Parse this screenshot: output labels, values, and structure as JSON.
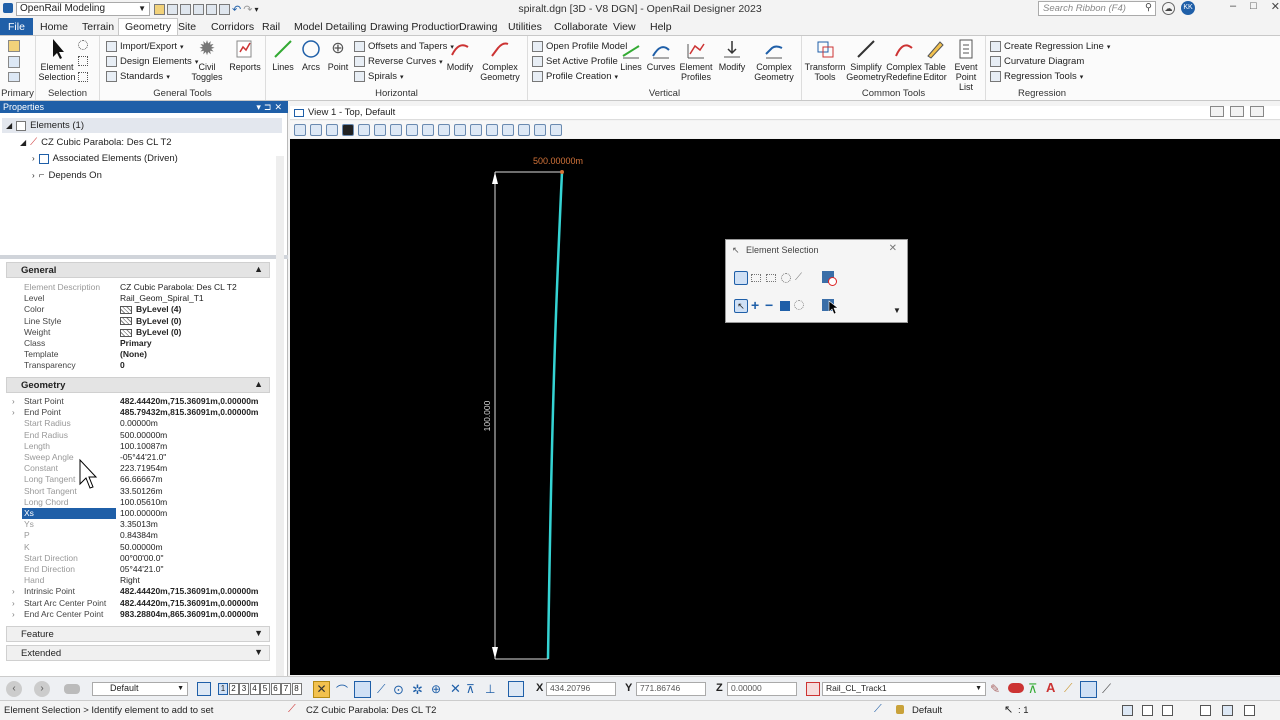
{
  "titlebar": {
    "workspace": "OpenRail Modeling",
    "title": "spiralt.dgn [3D - V8 DGN] - OpenRail Designer 2023",
    "search_placeholder": "Search Ribbon (F4)",
    "avatar": "KK"
  },
  "tabs": [
    "File",
    "Home",
    "Terrain",
    "Geometry",
    "Site",
    "Corridors",
    "Rail",
    "Model Detailing",
    "Drawing Production",
    "Drawing",
    "Utilities",
    "Collaborate",
    "View",
    "Help"
  ],
  "ribbon": {
    "primary": {
      "label": "Primary"
    },
    "selection": {
      "label": "Selection",
      "element_selection": "Element Selection"
    },
    "general_tools": {
      "label": "General Tools",
      "import_export": "Import/Export",
      "design_elements": "Design Elements",
      "standards": "Standards",
      "civil_toggles": "Civil Toggles",
      "reports": "Reports"
    },
    "horizontal": {
      "label": "Horizontal",
      "lines": "Lines",
      "arcs": "Arcs",
      "point": "Point",
      "offsets": "Offsets and Tapers",
      "reverse": "Reverse Curves",
      "spirals": "Spirals",
      "modify": "Modify",
      "complex": "Complex Geometry"
    },
    "vertical": {
      "label": "Vertical",
      "open_profile": "Open Profile Model",
      "set_active": "Set Active Profile",
      "profile_creation": "Profile Creation",
      "lines": "Lines",
      "curves": "Curves",
      "element_profiles": "Element Profiles",
      "modify": "Modify",
      "complex": "Complex Geometry"
    },
    "common": {
      "label": "Common Tools",
      "transform": "Transform Tools",
      "simplify": "Simplify Geometry",
      "complex_redefine": "Complex Redefine",
      "table_editor": "Table Editor",
      "event_point": "Event Point List"
    },
    "regression": {
      "label": "Regression",
      "create_line": "Create Regression Line",
      "curvature": "Curvature Diagram",
      "tools": "Regression Tools"
    }
  },
  "properties": {
    "header": "Properties",
    "tree": {
      "root": "Elements (1)",
      "element": "CZ Cubic Parabola: Des CL T2",
      "assoc": "Associated Elements (Driven)",
      "depends": "Depends On"
    },
    "general_label": "General",
    "general": [
      {
        "k": "Element Description",
        "v": "CZ Cubic Parabola: Des CL T2",
        "dim": true
      },
      {
        "k": "Level",
        "v": "Rail_Geom_Spiral_T1"
      },
      {
        "k": "Color",
        "v": "ByLevel (4)",
        "sw": true,
        "b": true
      },
      {
        "k": "Line Style",
        "v": "ByLevel (0)",
        "sw": true,
        "b": true
      },
      {
        "k": "Weight",
        "v": "ByLevel (0)",
        "sw": true,
        "b": true
      },
      {
        "k": "Class",
        "v": "Primary",
        "b": true
      },
      {
        "k": "Template",
        "v": "(None)",
        "b": true
      },
      {
        "k": "Transparency",
        "v": "0",
        "b": true
      }
    ],
    "geometry_label": "Geometry",
    "geometry": [
      {
        "k": "Start Point",
        "v": "482.44420m,715.36091m,0.00000m",
        "b": true,
        "ex": true
      },
      {
        "k": "End Point",
        "v": "485.79432m,815.36091m,0.00000m",
        "b": true,
        "ex": true
      },
      {
        "k": "Start Radius",
        "v": "0.00000m",
        "dim": true
      },
      {
        "k": "End Radius",
        "v": "500.00000m",
        "dim": true
      },
      {
        "k": "Length",
        "v": "100.10087m",
        "dim": true
      },
      {
        "k": "Sweep Angle",
        "v": "-05°44'21.0\"",
        "dim": true
      },
      {
        "k": "Constant",
        "v": "223.71954m",
        "dim": true
      },
      {
        "k": "Long Tangent",
        "v": "66.66667m",
        "dim": true
      },
      {
        "k": "Short Tangent",
        "v": "33.50126m",
        "dim": true
      },
      {
        "k": "Long Chord",
        "v": "100.05610m",
        "dim": true
      },
      {
        "k": "Xs",
        "v": "100.00000m",
        "sel": true
      },
      {
        "k": "Ys",
        "v": "3.35013m",
        "dim": true
      },
      {
        "k": "P",
        "v": "0.84384m",
        "dim": true
      },
      {
        "k": "K",
        "v": "50.00000m",
        "dim": true
      },
      {
        "k": "Start Direction",
        "v": "00°00'00.0\"",
        "dim": true
      },
      {
        "k": "End Direction",
        "v": "05°44'21.0\"",
        "dim": true
      },
      {
        "k": "Hand",
        "v": "Right",
        "dim": true
      },
      {
        "k": "Intrinsic Point",
        "v": "482.44420m,715.36091m,0.00000m",
        "b": true,
        "ex": true
      },
      {
        "k": "Start Arc Center Point",
        "v": "482.44420m,715.36091m,0.00000m",
        "b": true,
        "ex": true
      },
      {
        "k": "End Arc Center Point",
        "v": "983.28804m,865.36091m,0.00000m",
        "b": true,
        "ex": true
      }
    ],
    "feature_label": "Feature",
    "extended_label": "Extended"
  },
  "view": {
    "title": "View 1 - Top, Default",
    "dim_radius": "500.00000m",
    "dim_length": "100.000"
  },
  "element_selection": {
    "title": "Element Selection"
  },
  "bottombar": {
    "level": "Default",
    "views": [
      "1",
      "2",
      "3",
      "4",
      "5",
      "6",
      "7",
      "8"
    ],
    "x_label": "X",
    "x": "434.20796",
    "y_label": "Y",
    "y": "771.86746",
    "z_label": "Z",
    "z": "0.00000",
    "feature": "Rail_CL_Track1"
  },
  "statusbar": {
    "prompt": "Element Selection > Identify element to add to set",
    "element": "CZ Cubic Parabola: Des CL T2",
    "level": "Default",
    "scale": ": 1"
  },
  "colors": {
    "accent": "#1f5fa8",
    "alignment": "#35d4d4",
    "dimension": "#d4743a"
  }
}
